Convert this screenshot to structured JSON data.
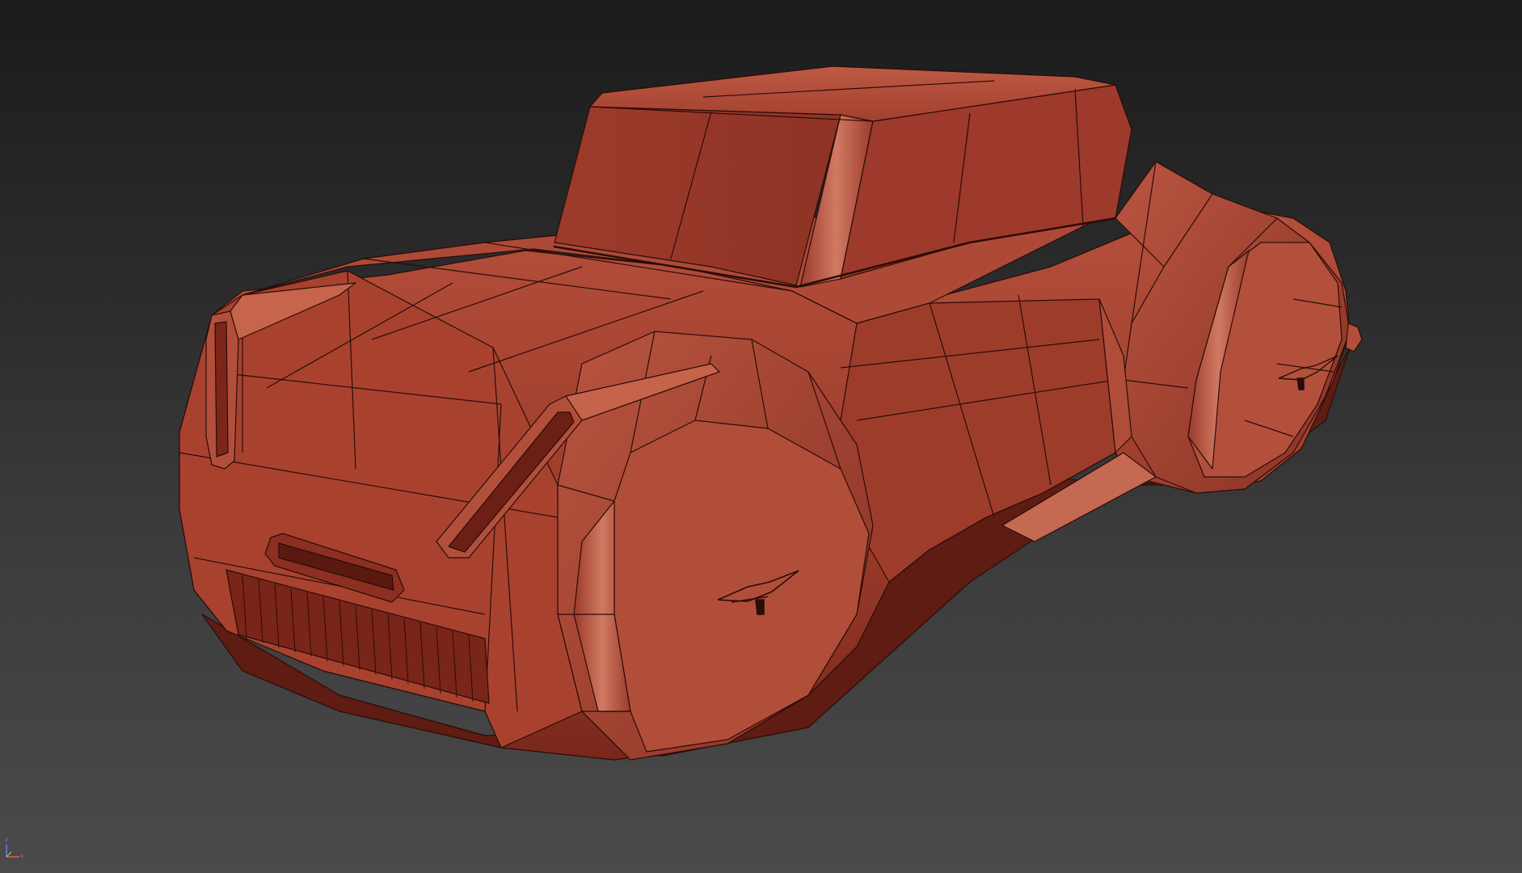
{
  "viewport": {
    "background_top": "#1b1b1b",
    "background_bottom": "#4a4a4a"
  },
  "model": {
    "icon": "hover-car-wireframe-model",
    "base_color": "#a8402f",
    "wire_color": "#2a0c08",
    "highlight_color": "#c2614c",
    "shadow_color": "#6e2018"
  },
  "axis_gizmo": {
    "z_label": "z",
    "x_label": "x",
    "z_color": "#6a7cff",
    "x_color": "#ff4a4a",
    "y_color": "#5cff5c"
  }
}
